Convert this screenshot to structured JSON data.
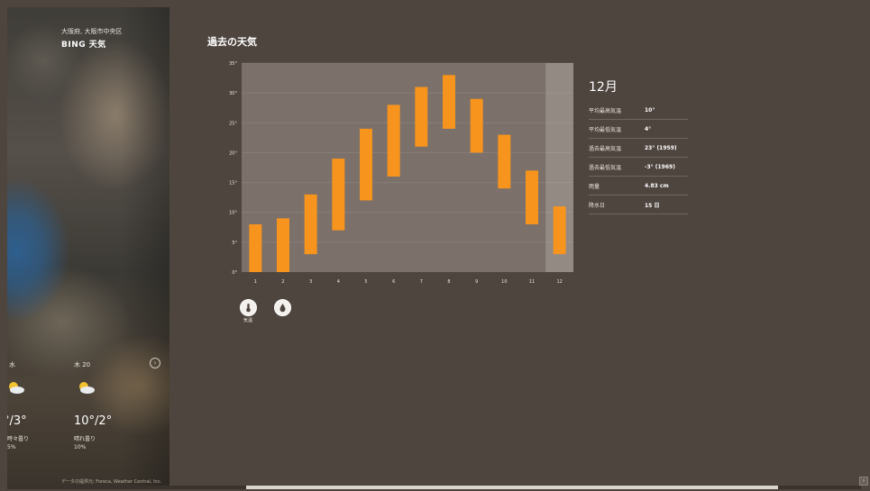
{
  "app": {
    "location": "大阪府, 大阪市中央区",
    "name": "BING 天気"
  },
  "forecast": [
    {
      "day": "水",
      "temp": "°/3°",
      "desc_line1": "時々曇り",
      "desc_line2": "5%"
    },
    {
      "day": "木 20",
      "temp": "10°/2°",
      "desc_line1": "晴れ曇り",
      "desc_line2": "10%"
    }
  ],
  "footer_note": "データの提供元: Foreca, Weather Central, Inc.",
  "section": {
    "title": "過去の天気"
  },
  "chart_data": {
    "type": "bar",
    "categories": [
      "1",
      "2",
      "3",
      "4",
      "5",
      "6",
      "7",
      "8",
      "9",
      "10",
      "11",
      "12"
    ],
    "series": [
      {
        "low": [
          0,
          0,
          3,
          7,
          12,
          16,
          21,
          24,
          20,
          14,
          8,
          3
        ],
        "high": [
          8,
          9,
          13,
          19,
          24,
          28,
          31,
          33,
          29,
          23,
          17,
          11
        ]
      }
    ],
    "y_ticks": [
      "0°",
      "5°",
      "10°",
      "15°",
      "20°",
      "25°",
      "30°",
      "35°"
    ],
    "ylim": [
      0,
      35
    ],
    "selected_index": 11,
    "bar_color": "#f7941d",
    "plot_bg": "#7b706a",
    "selected_bg": "#948a84"
  },
  "stats": {
    "month": "12月",
    "rows": [
      {
        "label": "平均最高気温",
        "value": "10°"
      },
      {
        "label": "平均最低気温",
        "value": "4°"
      },
      {
        "label": "過去最高気温",
        "value": "23° (1959)"
      },
      {
        "label": "過去最低気温",
        "value": "-3° (1969)"
      },
      {
        "label": "雨量",
        "value": "4.83 cm"
      },
      {
        "label": "降水日",
        "value": "15 日"
      }
    ]
  },
  "modes": {
    "temp_label": "気温"
  },
  "colors": {
    "background": "#4f453f",
    "accent": "#f7941d"
  }
}
